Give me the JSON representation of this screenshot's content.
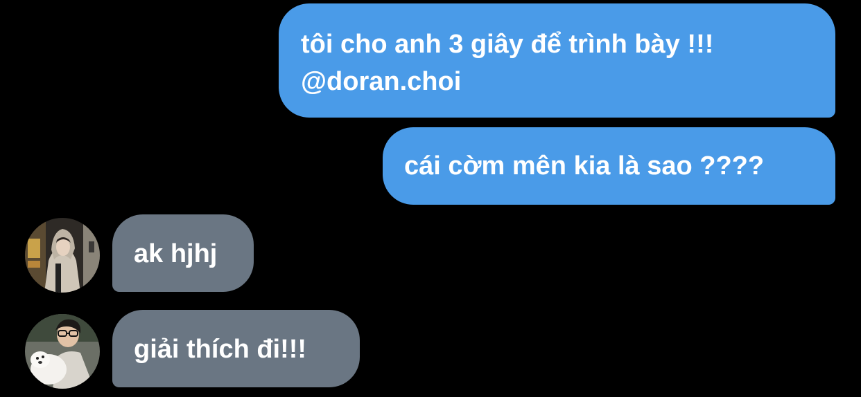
{
  "thread": {
    "messages": [
      {
        "direction": "sent",
        "lines": [
          "tôi cho anh 3 giây để trình bày !!!",
          "@doran.choi"
        ]
      },
      {
        "direction": "sent",
        "lines": [
          "cái cờm mên kia là sao ????"
        ]
      },
      {
        "direction": "received",
        "avatar_icon": "contact-avatar-hooded-person",
        "lines": [
          "ak hjhj"
        ]
      },
      {
        "direction": "received",
        "avatar_icon": "contact-avatar-person-with-dog",
        "lines": [
          "giải thích đi!!!"
        ]
      }
    ]
  },
  "colors": {
    "background": "#000000",
    "sent_bubble": "#4a9be8",
    "received_bubble": "#6a7683",
    "text": "#ffffff"
  }
}
